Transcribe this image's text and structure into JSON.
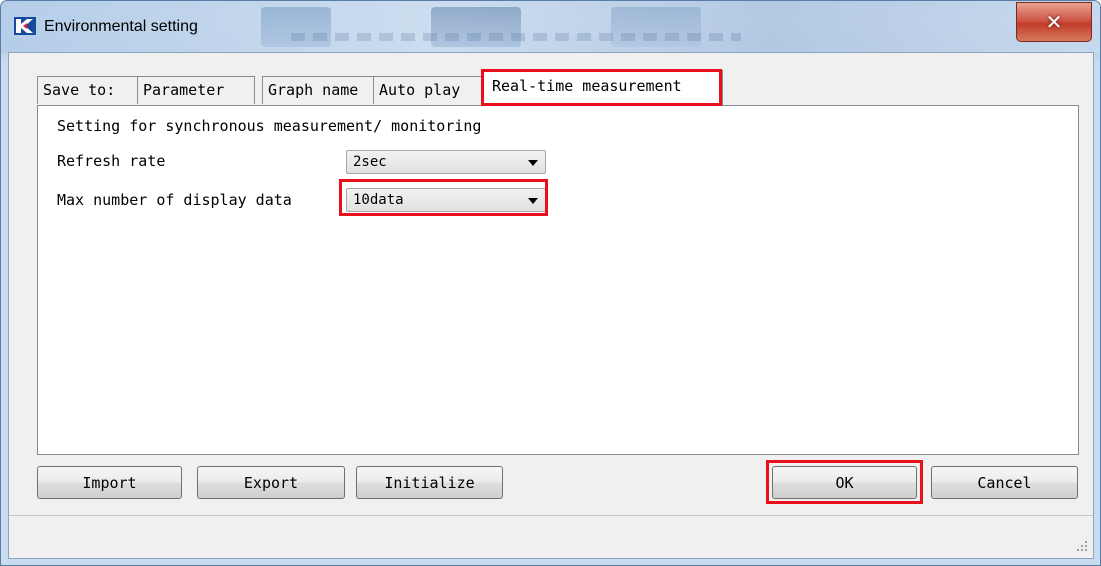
{
  "window": {
    "title": "Environmental setting",
    "close_label": "✕",
    "icon": "app-logo-icon"
  },
  "tabs": [
    {
      "label": "Save to:",
      "active": false
    },
    {
      "label": "Parameter",
      "active": false
    },
    {
      "label": "Graph name",
      "active": false
    },
    {
      "label": "Auto play",
      "active": false
    },
    {
      "label": "Real-time measurement",
      "active": true
    }
  ],
  "panel": {
    "heading": "Setting for synchronous measurement/ monitoring",
    "refresh_rate": {
      "label": "Refresh rate",
      "value": "2sec"
    },
    "max_display": {
      "label": "Max number of display data",
      "value": "10data"
    }
  },
  "buttons": {
    "import": "Import",
    "export": "Export",
    "initialize": "Initialize",
    "ok": "OK",
    "cancel": "Cancel"
  },
  "colors": {
    "highlight": "#e8101d",
    "close_button": "#c23c2a"
  }
}
